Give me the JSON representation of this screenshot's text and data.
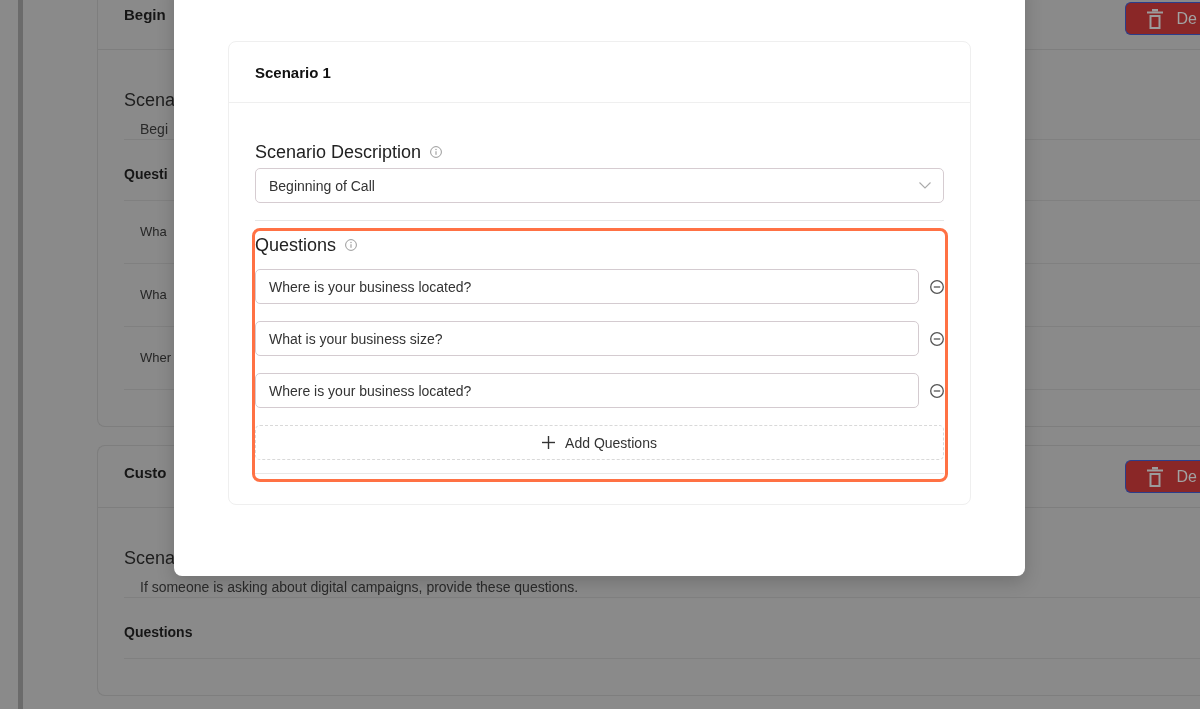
{
  "background": {
    "cards": [
      {
        "title": "Begin",
        "delete_label": "De",
        "scenario_label": "Scena",
        "scenario_value": "Begi",
        "questions_label": "Questi",
        "questions": [
          "Wha",
          "Wha",
          "Wher"
        ]
      },
      {
        "title": "Custo",
        "delete_label": "De",
        "scenario_label": "Scena",
        "scenario_value": "If someone is asking about digital campaigns, provide these questions.",
        "questions_label": "Questions"
      }
    ]
  },
  "dialog": {
    "card_title": "Scenario 1",
    "scenario_description": {
      "label": "Scenario Description",
      "value": "Beginning of Call"
    },
    "questions": {
      "label": "Questions",
      "highlighted": true,
      "items": [
        "Where is your business located?",
        "What is your business size?",
        "Where is your business located?"
      ],
      "add_label": "Add Questions"
    }
  }
}
